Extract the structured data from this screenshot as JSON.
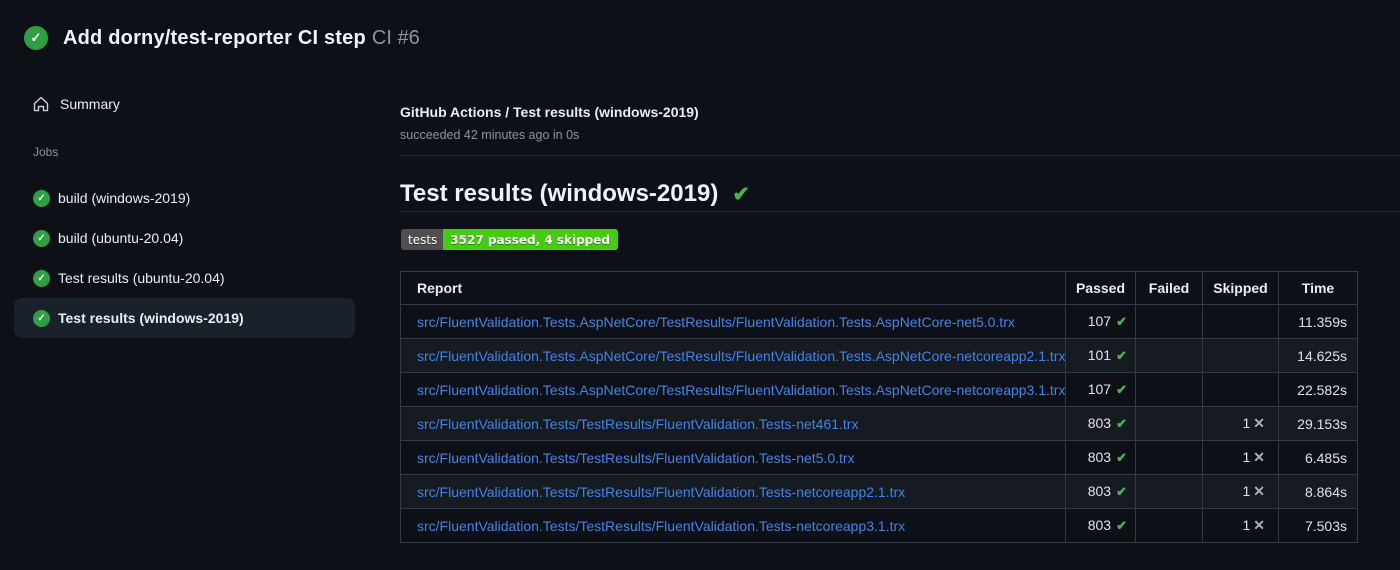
{
  "header": {
    "run_title": "Add dorny/test-reporter CI step",
    "run_number": "CI #6"
  },
  "sidebar": {
    "summary_label": "Summary",
    "jobs_label": "Jobs",
    "jobs": [
      {
        "label": "build (windows-2019)",
        "selected": false
      },
      {
        "label": "build (ubuntu-20.04)",
        "selected": false
      },
      {
        "label": "Test results (ubuntu-20.04)",
        "selected": false
      },
      {
        "label": "Test results (windows-2019)",
        "selected": true
      }
    ]
  },
  "main": {
    "breadcrumb": "GitHub Actions / Test results (windows-2019)",
    "status_line": "succeeded 42 minutes ago in 0s",
    "heading": "Test results (windows-2019)",
    "badge": {
      "label": "tests",
      "value": "3527 passed, 4 skipped"
    },
    "table": {
      "columns": [
        "Report",
        "Passed",
        "Failed",
        "Skipped",
        "Time"
      ],
      "rows": [
        {
          "report": "src/FluentValidation.Tests.AspNetCore/TestResults/FluentValidation.Tests.AspNetCore-net5.0.trx",
          "passed": "107",
          "failed": "",
          "skipped": "",
          "time": "11.359s"
        },
        {
          "report": "src/FluentValidation.Tests.AspNetCore/TestResults/FluentValidation.Tests.AspNetCore-netcoreapp2.1.trx",
          "passed": "101",
          "failed": "",
          "skipped": "",
          "time": "14.625s"
        },
        {
          "report": "src/FluentValidation.Tests.AspNetCore/TestResults/FluentValidation.Tests.AspNetCore-netcoreapp3.1.trx",
          "passed": "107",
          "failed": "",
          "skipped": "",
          "time": "22.582s"
        },
        {
          "report": "src/FluentValidation.Tests/TestResults/FluentValidation.Tests-net461.trx",
          "passed": "803",
          "failed": "",
          "skipped": "1",
          "time": "29.153s"
        },
        {
          "report": "src/FluentValidation.Tests/TestResults/FluentValidation.Tests-net5.0.trx",
          "passed": "803",
          "failed": "",
          "skipped": "1",
          "time": "6.485s"
        },
        {
          "report": "src/FluentValidation.Tests/TestResults/FluentValidation.Tests-netcoreapp2.1.trx",
          "passed": "803",
          "failed": "",
          "skipped": "1",
          "time": "8.864s"
        },
        {
          "report": "src/FluentValidation.Tests/TestResults/FluentValidation.Tests-netcoreapp3.1.trx",
          "passed": "803",
          "failed": "",
          "skipped": "1",
          "time": "7.503s"
        }
      ]
    }
  },
  "icons": {
    "status_check": "check-circle",
    "summary": "home",
    "passed_mark": "check",
    "skipped_mark": "x"
  },
  "colors": {
    "page_bg": "#0d1117",
    "success_green": "#2ea043",
    "check_green": "#3fb950",
    "link_blue": "#4184e4",
    "muted_text": "#8b949e",
    "selected_item_bg": "#1b212b",
    "table_border": "#343b44",
    "stripe_row_bg": "#161b22",
    "badge_label_bg": "#4f4f4f",
    "badge_value_bg": "#44cc11"
  }
}
